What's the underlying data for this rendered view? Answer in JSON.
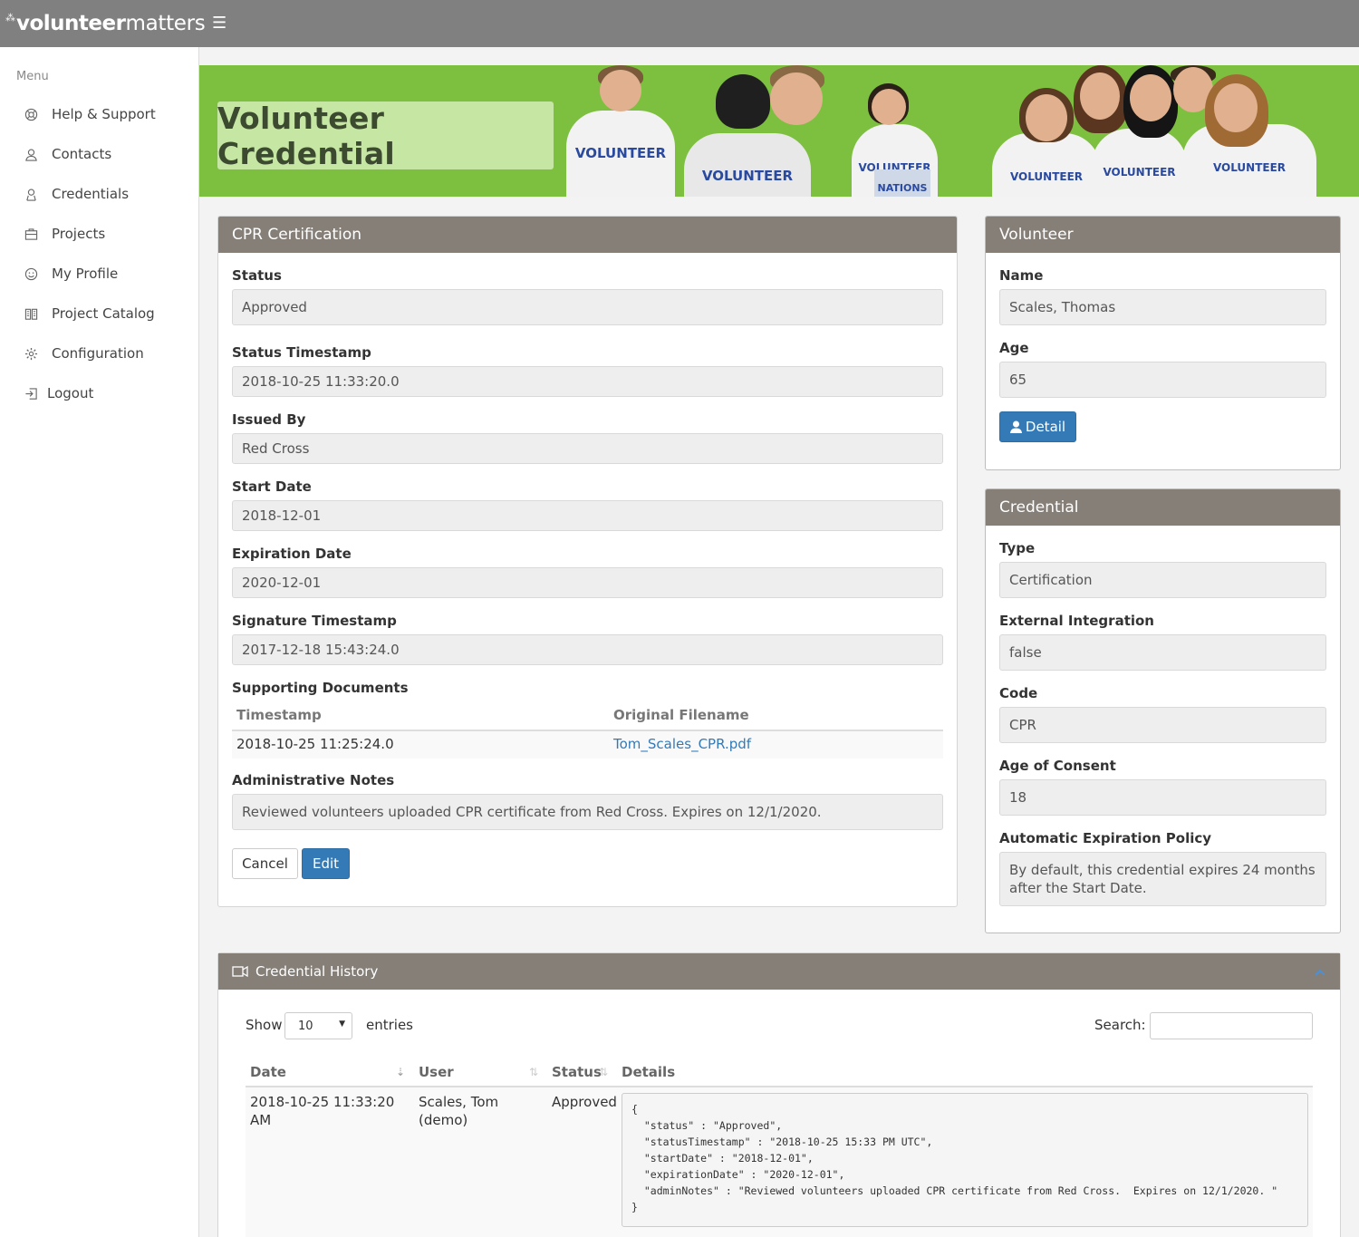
{
  "brand": {
    "bold": "volunteer",
    "light": "matters"
  },
  "sidebar": {
    "menu_label": "Menu",
    "items": [
      {
        "label": "Help & Support",
        "icon": "support-icon"
      },
      {
        "label": "Contacts",
        "icon": "contacts-icon"
      },
      {
        "label": "Credentials",
        "icon": "credentials-icon"
      },
      {
        "label": "Projects",
        "icon": "projects-icon"
      },
      {
        "label": "My Profile",
        "icon": "smiley-icon"
      },
      {
        "label": "Project Catalog",
        "icon": "catalog-icon"
      },
      {
        "label": "Configuration",
        "icon": "gear-icon"
      },
      {
        "label": "Logout",
        "icon": "logout-icon"
      }
    ]
  },
  "banner": {
    "title": "Volunteer Credential",
    "shirt_text": "VOLUNTEER",
    "box_text": "NATIONS"
  },
  "credential_panel": {
    "title": "CPR Certification",
    "status_label": "Status",
    "status": "Approved",
    "status_ts_label": "Status Timestamp",
    "status_ts": "2018-10-25 11:33:20.0",
    "issued_by_label": "Issued By",
    "issued_by": "Red Cross",
    "start_date_label": "Start Date",
    "start_date": "2018-12-01",
    "exp_date_label": "Expiration Date",
    "exp_date": "2020-12-01",
    "sig_ts_label": "Signature Timestamp",
    "sig_ts": "2017-12-18 15:43:24.0",
    "docs_label": "Supporting Documents",
    "docs_columns": [
      "Timestamp",
      "Original Filename"
    ],
    "docs_rows": [
      {
        "timestamp": "2018-10-25 11:25:24.0",
        "filename": "Tom_Scales_CPR.pdf"
      }
    ],
    "notes_label": "Administrative Notes",
    "notes": "Reviewed volunteers uploaded CPR certificate from Red Cross. Expires on 12/1/2020.",
    "cancel": "Cancel",
    "edit": "Edit"
  },
  "volunteer_panel": {
    "title": "Volunteer",
    "name_label": "Name",
    "name": "Scales, Thomas",
    "age_label": "Age",
    "age": "65",
    "detail": "Detail"
  },
  "credential_info": {
    "title": "Credential",
    "type_label": "Type",
    "type": "Certification",
    "ext_label": "External Integration",
    "ext": "false",
    "code_label": "Code",
    "code": "CPR",
    "consent_label": "Age of Consent",
    "consent": "18",
    "policy_label": "Automatic Expiration Policy",
    "policy": "By default, this credential expires 24 months after the Start Date."
  },
  "history": {
    "title": "Credential History",
    "show": "Show",
    "entries_value": "10",
    "entries": "entries",
    "search_label": "Search:",
    "columns": [
      "Date",
      "User",
      "Status",
      "Details"
    ],
    "rows": [
      {
        "date": "2018-10-25 11:33:20 AM",
        "user": "Scales, Tom (demo)",
        "status": "Approved",
        "details": "{\n  \"status\" : \"Approved\",\n  \"statusTimestamp\" : \"2018-10-25 15:33 PM UTC\",\n  \"startDate\" : \"2018-12-01\",\n  \"expirationDate\" : \"2020-12-01\",\n  \"adminNotes\" : \"Reviewed volunteers uploaded CPR certificate from Red Cross.  Expires on 12/1/2020. \"\n}"
      }
    ]
  },
  "colors": {
    "topbar": "#808080",
    "banner_green": "#7dbf3f",
    "panel_header": "#857f78",
    "primary": "#337ab7",
    "link": "#337ab7"
  }
}
